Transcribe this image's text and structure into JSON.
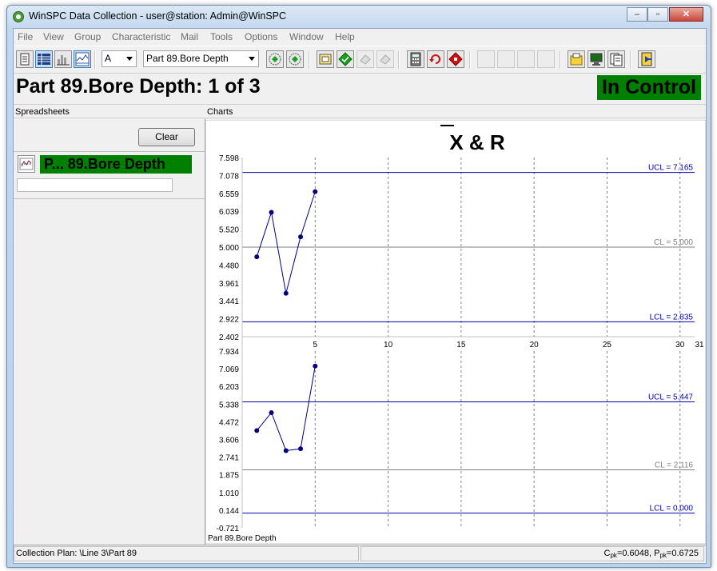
{
  "window": {
    "title": "WinSPC Data Collection - user@station: Admin@WinSPC",
    "minimize": "–",
    "maximize": "▫",
    "close": "✕"
  },
  "menu": [
    "File",
    "View",
    "Group",
    "Characteristic",
    "Mail",
    "Tools",
    "Options",
    "Window",
    "Help"
  ],
  "toolbar": {
    "group_combo": "A",
    "characteristic_combo": "Part 89.Bore Depth"
  },
  "header": {
    "part_title": "Part 89.Bore Depth:  1 of 3",
    "status": "In Control"
  },
  "panes": {
    "spreadsheets": "Spreadsheets",
    "charts": "Charts"
  },
  "spreadsheet": {
    "clear_label": "Clear",
    "sheet_label": "P... 89.Bore Depth"
  },
  "chart_data": [
    {
      "type": "line",
      "title": "X & R",
      "name": "X-bar",
      "x": [
        1,
        2,
        3,
        4,
        5
      ],
      "values": [
        4.72,
        6.01,
        3.66,
        5.3,
        6.61
      ],
      "ylim": [
        2.402,
        7.598
      ],
      "yticks": [
        "7.598",
        "7.078",
        "6.559",
        "6.039",
        "5.520",
        "5.000",
        "4.480",
        "3.961",
        "3.441",
        "2.922",
        "2.402"
      ],
      "xlim": [
        0,
        31
      ],
      "xticks": [
        5,
        10,
        15,
        20,
        25,
        30,
        31
      ],
      "lines": [
        {
          "label": "UCL = 7.165",
          "value": 7.165,
          "color": "#0000aa"
        },
        {
          "label": "CL = 5.000",
          "value": 5.0,
          "color": "#808080"
        },
        {
          "label": "LCL = 2.835",
          "value": 2.835,
          "color": "#0000aa"
        }
      ],
      "grid": "vertical dashed"
    },
    {
      "type": "line",
      "name": "Range",
      "x": [
        1,
        2,
        3,
        4,
        5
      ],
      "values": [
        4.04,
        4.92,
        3.06,
        3.15,
        7.2
      ],
      "ylim": [
        -0.721,
        7.934
      ],
      "yticks": [
        "7.934",
        "7.069",
        "6.203",
        "5.338",
        "4.472",
        "3.606",
        "2.741",
        "1.875",
        "1.010",
        "0.144",
        "-0.721"
      ],
      "xlim": [
        0,
        31
      ],
      "lines": [
        {
          "label": "UCL = 5.447",
          "value": 5.447,
          "color": "#0000aa"
        },
        {
          "label": "CL = 2.116",
          "value": 2.116,
          "color": "#808080"
        },
        {
          "label": "LCL = 0.000",
          "value": 0.0,
          "color": "#0000aa"
        }
      ],
      "grid": "vertical dashed"
    }
  ],
  "chart_footer": "Part 89.Bore Depth",
  "status": {
    "collection_plan": "Collection Plan: \\Line 3\\Part 89",
    "cpk_c": "C",
    "cpk_sub": "pk",
    "cpk_val": "=0.6048, ",
    "ppk_p": "P",
    "ppk_sub": "pk",
    "ppk_val": "=0.6725"
  },
  "colors": {
    "in_control": "#008000",
    "point": "#000080",
    "control_line": "#0000aa",
    "center_line": "#808080"
  }
}
